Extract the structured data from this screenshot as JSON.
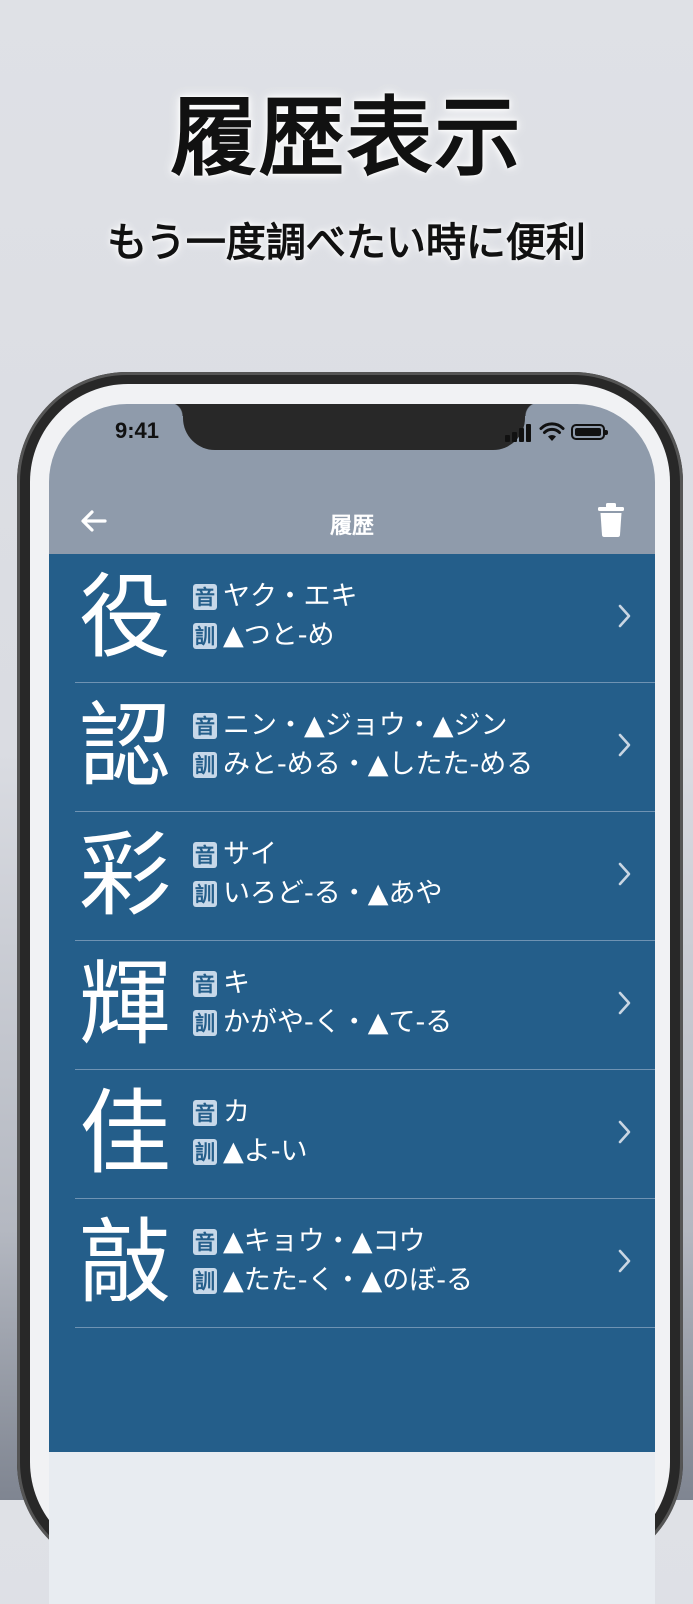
{
  "promo": {
    "headline": "履歴表示",
    "subheadline": "もう一度調べたい時に便利"
  },
  "status_bar": {
    "time": "9:41"
  },
  "nav": {
    "title": "履歴"
  },
  "labels": {
    "on": "音",
    "kun": "訓"
  },
  "history": [
    {
      "kanji": "役",
      "on": "ヤク・エキ",
      "kun": "▲つと-め"
    },
    {
      "kanji": "認",
      "on": "ニン・▲ジョウ・▲ジン",
      "kun": "みと-める・▲したた-める"
    },
    {
      "kanji": "彩",
      "on": "サイ",
      "kun": "いろど-る・▲あや"
    },
    {
      "kanji": "輝",
      "on": "キ",
      "kun": "かがや-く・▲て-る"
    },
    {
      "kanji": "佳",
      "on": "カ",
      "kun": "▲よ-い"
    },
    {
      "kanji": "敲",
      "on": "▲キョウ・▲コウ",
      "kun": "▲たた-く・▲のぼ-る"
    }
  ],
  "colors": {
    "list_background": "#245e8a",
    "nav_background": "#8f9bab",
    "row_divider": "#6f93b3"
  }
}
